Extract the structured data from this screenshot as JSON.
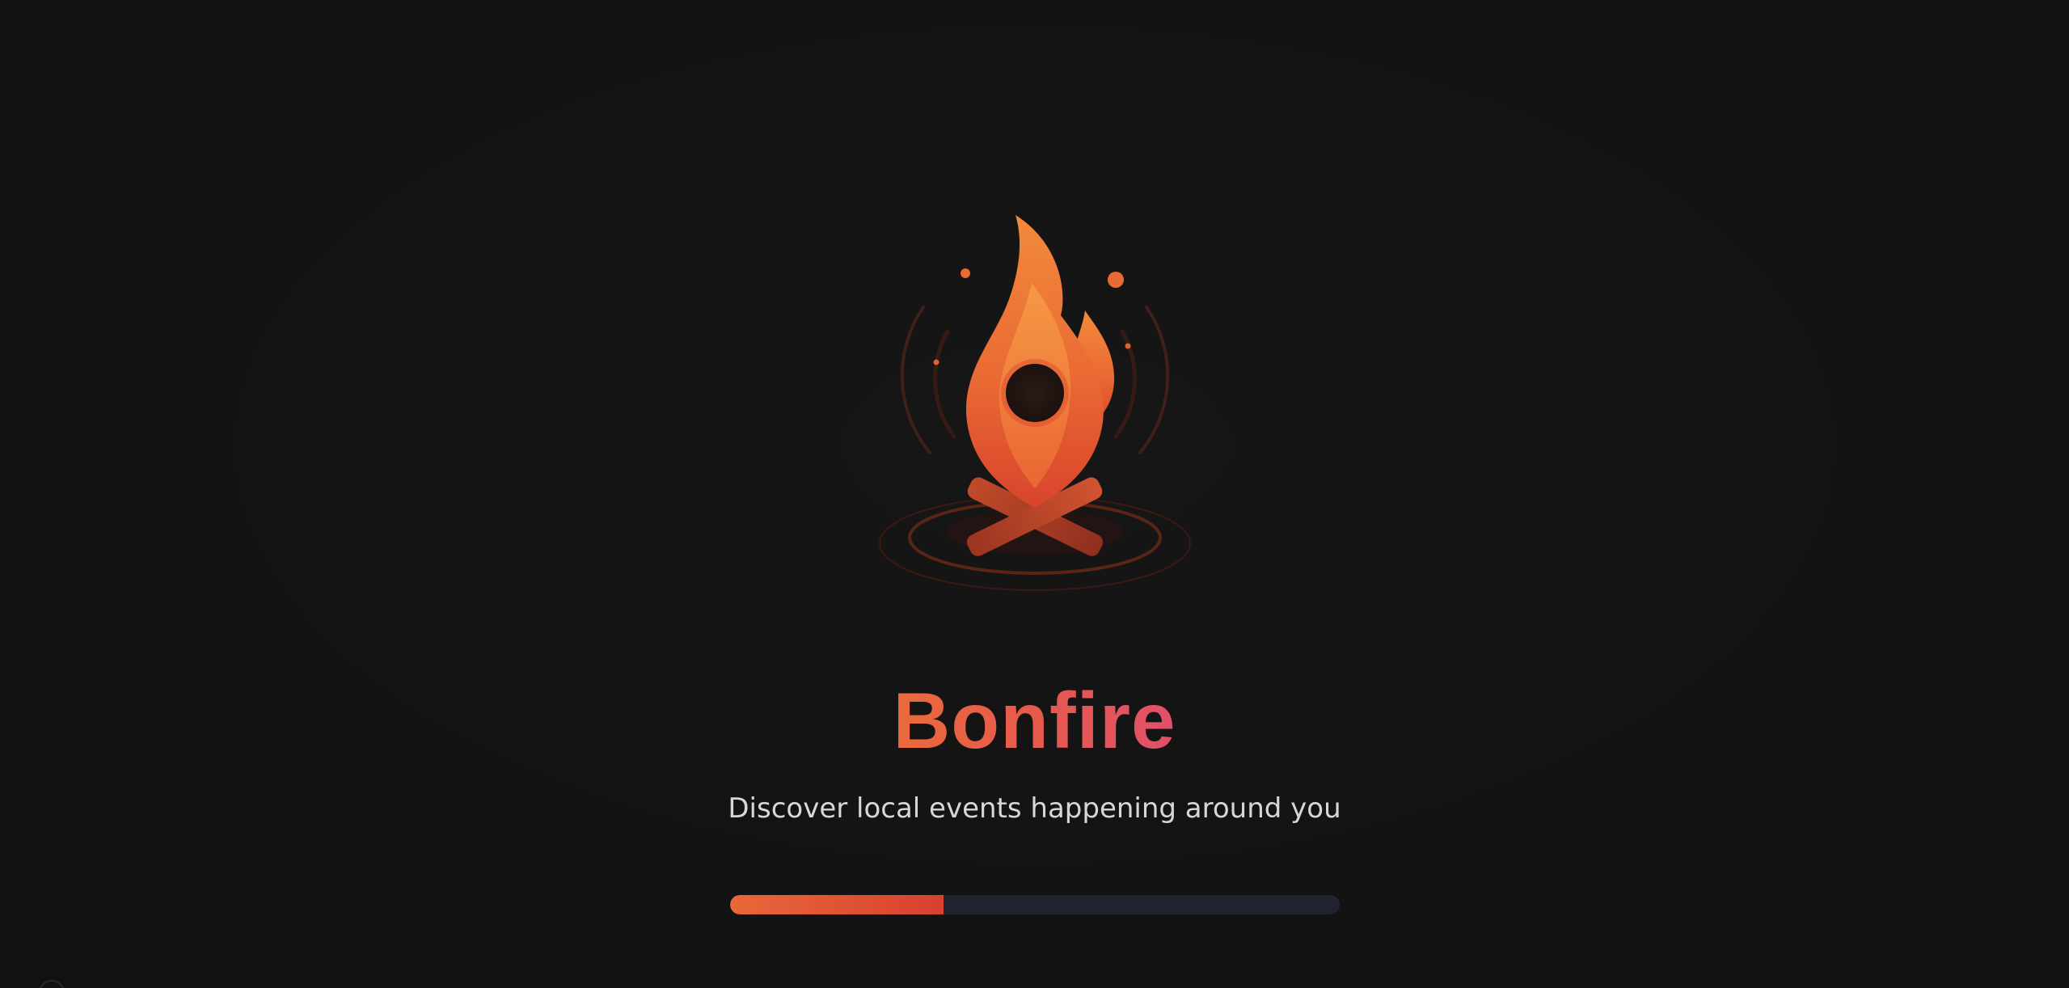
{
  "app": {
    "name": "Bonfire",
    "tagline": "Discover local events happening around you"
  },
  "logo": {
    "icon": "bonfire-location-pin-flame-icon"
  },
  "loading": {
    "progress_percent": 35
  },
  "colors": {
    "background": "#141414",
    "accent_orange": "#e8683a",
    "accent_red": "#d8402f",
    "accent_pink": "#e0506a",
    "track": "#1f2430",
    "subtitle": "#d7d7d9"
  }
}
